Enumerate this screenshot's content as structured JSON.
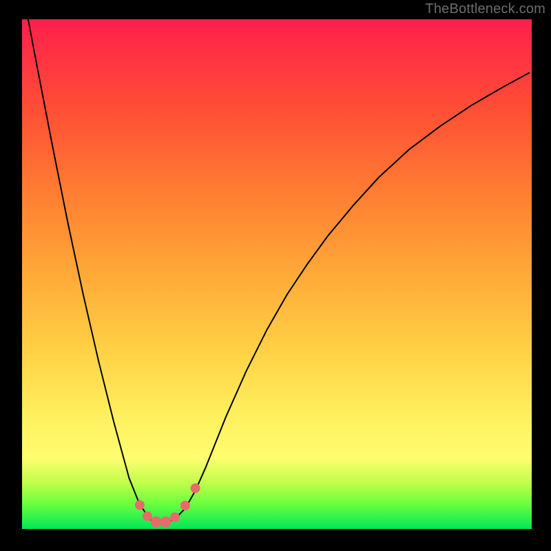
{
  "watermark": "TheBottleneck.com",
  "chart_data": {
    "type": "line",
    "title": "",
    "xlabel": "",
    "ylabel": "",
    "xlim": [
      0,
      1
    ],
    "ylim": [
      0,
      1
    ],
    "series": [
      {
        "name": "curve",
        "x": [
          0.01,
          0.03,
          0.06,
          0.09,
          0.12,
          0.15,
          0.18,
          0.21,
          0.23,
          0.25,
          0.262,
          0.28,
          0.3,
          0.32,
          0.34,
          0.36,
          0.4,
          0.44,
          0.48,
          0.52,
          0.56,
          0.6,
          0.65,
          0.7,
          0.76,
          0.82,
          0.88,
          0.94,
          0.995
        ],
        "y": [
          1.01,
          0.905,
          0.75,
          0.6,
          0.46,
          0.33,
          0.21,
          0.1,
          0.05,
          0.02,
          0.01,
          0.01,
          0.02,
          0.04,
          0.075,
          0.12,
          0.22,
          0.31,
          0.39,
          0.46,
          0.52,
          0.575,
          0.635,
          0.69,
          0.745,
          0.79,
          0.83,
          0.865,
          0.895
        ]
      }
    ],
    "markers": [
      {
        "x": 0.231,
        "y": 0.047,
        "r": 7
      },
      {
        "x": 0.246,
        "y": 0.025,
        "r": 7
      },
      {
        "x": 0.263,
        "y": 0.014,
        "r": 8
      },
      {
        "x": 0.282,
        "y": 0.014,
        "r": 8
      },
      {
        "x": 0.3,
        "y": 0.023,
        "r": 7
      },
      {
        "x": 0.32,
        "y": 0.046,
        "r": 7
      },
      {
        "x": 0.34,
        "y": 0.08,
        "r": 7
      }
    ],
    "marker_color": "#e86a6a",
    "background_gradient": [
      "#00e756",
      "#fffd70",
      "#ff7d32",
      "#ff1f4b"
    ]
  }
}
